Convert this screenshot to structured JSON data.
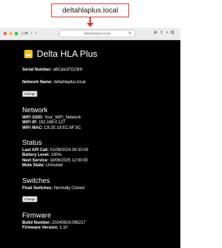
{
  "callout": {
    "text": "deltahlaplus.local"
  },
  "browser": {
    "url": "deltahlaplus.local",
    "reload_icon": "reload-icon"
  },
  "app": {
    "title": "Delta HLA Plus",
    "logo_color": "#f2c500"
  },
  "device": {
    "serial_label": "Serial Number:",
    "serial_value": "aBCde1FG23Hi",
    "network_name_label": "Network Name:",
    "network_name_value": "deltahlaplus.local",
    "change_label": "Change"
  },
  "network": {
    "heading": "Network",
    "ssid_label": "WiFi SSID:",
    "ssid_value": "Your_WiFi_Network",
    "ip_label": "WiFi IP:",
    "ip_value": "192.168.0.127",
    "mac_label": "WiFi MAC:",
    "mac_value": "C8:2E:18:EC:6F:5C"
  },
  "status": {
    "heading": "Status",
    "api_label": "Last API Call:",
    "api_value": "01/09/2024 09:30:00",
    "battery_label": "Battery Level:",
    "battery_value": "100%",
    "service_label": "Next Service:",
    "service_value": "18/06/2025 12:00:00",
    "mute_label": "Mute State:",
    "mute_value": "Unmuted"
  },
  "switches": {
    "heading": "Switches",
    "float_label": "Float Switches:",
    "float_value": "Normally Closed",
    "change_label": "Change"
  },
  "firmware": {
    "heading": "Firmware",
    "build_label": "Build Number:",
    "build_value": "20240819.095217",
    "version_label": "Firmware Version:",
    "version_value": "1.10"
  },
  "colors": {
    "callout_border": "#d9342b",
    "page_bg": "#000000",
    "accent": "#f2c500"
  }
}
